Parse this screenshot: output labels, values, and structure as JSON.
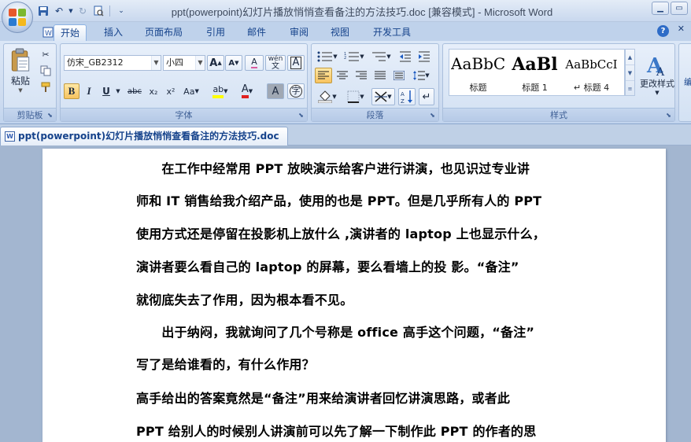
{
  "window": {
    "title": "ppt(powerpoint)幻灯片播放悄悄查看备注的方法技巧.doc [兼容模式] - Microsoft Word"
  },
  "ribbon_tabs": [
    {
      "label": "开始",
      "active": true
    },
    {
      "label": "插入"
    },
    {
      "label": "页面布局"
    },
    {
      "label": "引用"
    },
    {
      "label": "邮件"
    },
    {
      "label": "审阅"
    },
    {
      "label": "视图"
    },
    {
      "label": "开发工具"
    }
  ],
  "clipboard": {
    "paste_label": "粘贴",
    "group_label": "剪贴板"
  },
  "font": {
    "font_name": "仿宋_GB2312",
    "font_size": "小四",
    "group_label": "字体",
    "font_color": "#e02020",
    "highlight_color": "#ffff00",
    "grow_label": "A",
    "shrink_label": "A",
    "clear_label": "A",
    "phonetic_label": "wén",
    "char_border_label": "A",
    "bold_label": "B",
    "italic_label": "I",
    "underline_label": "U",
    "strike_label": "abc",
    "subscript_label": "x₂",
    "superscript_label": "x²",
    "case_label": "Aa",
    "char_shading_label": "A",
    "enclose_label": "字"
  },
  "paragraph": {
    "group_label": "段落"
  },
  "styles": {
    "group_label": "样式",
    "items": [
      {
        "sample": "AaBbC",
        "name": "标题"
      },
      {
        "sample": "AaBl",
        "name": "标题 1"
      },
      {
        "sample": "AaBbCcI",
        "name": "↵ 标题 4"
      }
    ],
    "change_styles_label": "更改样式"
  },
  "document_tab": {
    "label": "ppt(powerpoint)幻灯片播放悄悄查看备注的方法技巧.doc"
  },
  "document": {
    "lines": [
      "　　在工作中经常用 PPT 放映演示给客户进行讲演，也见识过专业讲",
      "师和 IT 销售给我介绍产品，使用的也是 PPT。但是几乎所有人的 PPT",
      "使用方式还是停留在投影机上放什么 ,演讲者的 laptop 上也显示什么，",
      "演讲者要么看自己的 laptop 的屏幕，要么看墙上的投  影。“备注”",
      "就彻底失去了作用，因为根本看不见。",
      "　　出于纳闷，我就询问了几个号称是 office 高手这个问题，“备注”",
      "写了是给谁看的，有什么作用？",
      "高手给出的答案竟然是“备注”用来给演讲者回忆讲演思路，或者此",
      "PPT 给别人的时候别人讲演前可以先了解一下制作此 PPT 的作者的思"
    ]
  }
}
